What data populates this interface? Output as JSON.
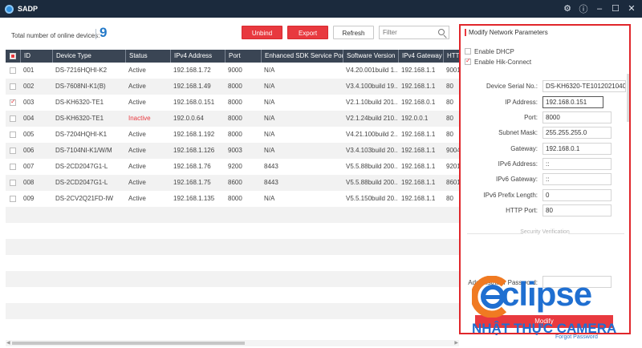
{
  "app": {
    "title": "SADP"
  },
  "toolbar": {
    "count_label": "Total number of online devices:",
    "count_value": "9",
    "unbind_label": "Unbind",
    "export_label": "Export",
    "refresh_label": "Refresh",
    "filter_placeholder": "Filter"
  },
  "table": {
    "columns": [
      "ID",
      "Device Type",
      "Status",
      "IPv4 Address",
      "Port",
      "Enhanced SDK Service Port",
      "Software Version",
      "IPv4 Gateway",
      "HTTP"
    ],
    "rows": [
      {
        "id": "001",
        "type": "DS-7216HQHI-K2",
        "status": "Active",
        "ip": "192.168.1.72",
        "port": "9000",
        "sdk": "N/A",
        "version": "V4.20.001build 1...",
        "gateway": "192.168.1.1",
        "http": "9001",
        "checked": false,
        "inactive": false
      },
      {
        "id": "002",
        "type": "DS-7608NI-K1(B)",
        "status": "Active",
        "ip": "192.168.1.49",
        "port": "8000",
        "sdk": "N/A",
        "version": "V3.4.100build 19...",
        "gateway": "192.168.1.1",
        "http": "80",
        "checked": false,
        "inactive": false
      },
      {
        "id": "003",
        "type": "DS-KH6320-TE1",
        "status": "Active",
        "ip": "192.168.0.151",
        "port": "8000",
        "sdk": "N/A",
        "version": "V2.1.10build 201...",
        "gateway": "192.168.0.1",
        "http": "80",
        "checked": true,
        "inactive": false
      },
      {
        "id": "004",
        "type": "DS-KH6320-TE1",
        "status": "Inactive",
        "ip": "192.0.0.64",
        "port": "8000",
        "sdk": "N/A",
        "version": "V2.1.24build 210...",
        "gateway": "192.0.0.1",
        "http": "80",
        "checked": false,
        "inactive": true
      },
      {
        "id": "005",
        "type": "DS-7204HQHI-K1",
        "status": "Active",
        "ip": "192.168.1.192",
        "port": "8000",
        "sdk": "N/A",
        "version": "V4.21.100build 2...",
        "gateway": "192.168.1.1",
        "http": "80",
        "checked": false,
        "inactive": false
      },
      {
        "id": "006",
        "type": "DS-7104NI-K1/W/M",
        "status": "Active",
        "ip": "192.168.1.126",
        "port": "9003",
        "sdk": "N/A",
        "version": "V3.4.103build 20...",
        "gateway": "192.168.1.1",
        "http": "9004",
        "checked": false,
        "inactive": false
      },
      {
        "id": "007",
        "type": "DS-2CD2047G1-L",
        "status": "Active",
        "ip": "192.168.1.76",
        "port": "9200",
        "sdk": "8443",
        "version": "V5.5.88build 200...",
        "gateway": "192.168.1.1",
        "http": "9201",
        "checked": false,
        "inactive": false
      },
      {
        "id": "008",
        "type": "DS-2CD2047G1-L",
        "status": "Active",
        "ip": "192.168.1.75",
        "port": "8600",
        "sdk": "8443",
        "version": "V5.5.88build 200...",
        "gateway": "192.168.1.1",
        "http": "8601",
        "checked": false,
        "inactive": false
      },
      {
        "id": "009",
        "type": "DS-2CV2Q21FD-IW",
        "status": "Active",
        "ip": "192.168.1.135",
        "port": "8000",
        "sdk": "N/A",
        "version": "V5.5.150build 20...",
        "gateway": "192.168.1.1",
        "http": "80",
        "checked": false,
        "inactive": false
      }
    ]
  },
  "panel": {
    "title": "Modify Network Parameters",
    "enable_dhcp": {
      "label": "Enable DHCP",
      "checked": false
    },
    "enable_hik": {
      "label": "Enable Hik-Connect",
      "checked": true
    },
    "fields": [
      {
        "label": "Device Serial No.:",
        "value": "DS-KH6320-TE10120210401WRQ0"
      },
      {
        "label": "IP Address:",
        "value": "192.168.0.151"
      },
      {
        "label": "Port:",
        "value": "8000"
      },
      {
        "label": "Subnet Mask:",
        "value": "255.255.255.0"
      },
      {
        "label": "Gateway:",
        "value": "192.168.0.1"
      },
      {
        "label": "IPv6 Address:",
        "value": "::"
      },
      {
        "label": "IPv6 Gateway:",
        "value": "::"
      },
      {
        "label": "IPv6 Prefix Length:",
        "value": "0"
      },
      {
        "label": "HTTP Port:",
        "value": "80"
      }
    ],
    "security_label": "Security Verification",
    "admin_password_label": "Administrator Password:",
    "modify_label": "Modify",
    "forgot_label": "Forgot Password"
  },
  "watermark": {
    "brand": "clipse",
    "subtitle": "NHẬT THỰC CAMERA"
  },
  "colors": {
    "accent_red": "#e8393f",
    "titlebar": "#1b2a3d",
    "header": "#3a4554",
    "link_blue": "#2479c8"
  }
}
